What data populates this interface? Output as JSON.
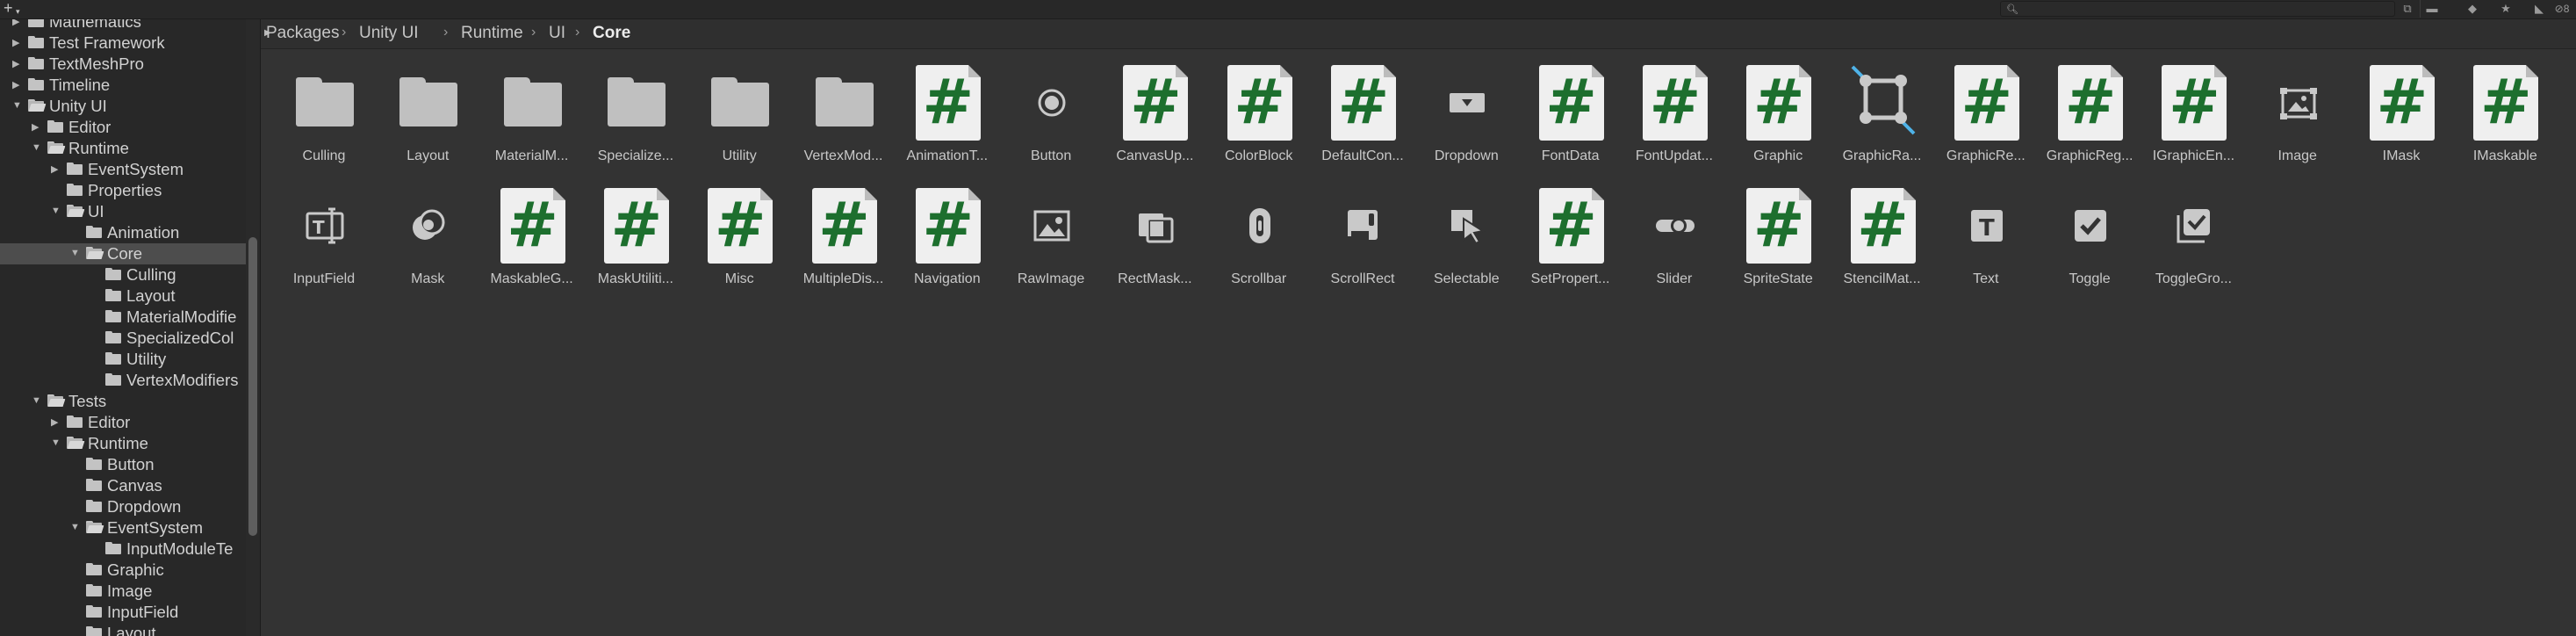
{
  "toolbar": {
    "add_icon": "plus-icon",
    "search_placeholder": "",
    "hidden_count": "8"
  },
  "tree": {
    "items": [
      {
        "label": "Mathematics",
        "depth": 1,
        "expanded": false,
        "has_children": true,
        "selected": false
      },
      {
        "label": "Test Framework",
        "depth": 1,
        "expanded": false,
        "has_children": true,
        "selected": false
      },
      {
        "label": "TextMeshPro",
        "depth": 1,
        "expanded": false,
        "has_children": true,
        "selected": false
      },
      {
        "label": "Timeline",
        "depth": 1,
        "expanded": false,
        "has_children": true,
        "selected": false
      },
      {
        "label": "Unity UI",
        "depth": 1,
        "expanded": true,
        "has_children": true,
        "selected": false
      },
      {
        "label": "Editor",
        "depth": 2,
        "expanded": false,
        "has_children": true,
        "selected": false
      },
      {
        "label": "Runtime",
        "depth": 2,
        "expanded": true,
        "has_children": true,
        "selected": false
      },
      {
        "label": "EventSystem",
        "depth": 3,
        "expanded": false,
        "has_children": true,
        "selected": false
      },
      {
        "label": "Properties",
        "depth": 3,
        "expanded": false,
        "has_children": false,
        "selected": false
      },
      {
        "label": "UI",
        "depth": 3,
        "expanded": true,
        "has_children": true,
        "selected": false
      },
      {
        "label": "Animation",
        "depth": 4,
        "expanded": false,
        "has_children": false,
        "selected": false
      },
      {
        "label": "Core",
        "depth": 4,
        "expanded": true,
        "has_children": true,
        "selected": true
      },
      {
        "label": "Culling",
        "depth": 5,
        "expanded": false,
        "has_children": false,
        "selected": false
      },
      {
        "label": "Layout",
        "depth": 5,
        "expanded": false,
        "has_children": false,
        "selected": false
      },
      {
        "label": "MaterialModifie",
        "depth": 5,
        "expanded": false,
        "has_children": false,
        "selected": false
      },
      {
        "label": "SpecializedCol",
        "depth": 5,
        "expanded": false,
        "has_children": false,
        "selected": false
      },
      {
        "label": "Utility",
        "depth": 5,
        "expanded": false,
        "has_children": false,
        "selected": false
      },
      {
        "label": "VertexModifiers",
        "depth": 5,
        "expanded": false,
        "has_children": false,
        "selected": false
      },
      {
        "label": "Tests",
        "depth": 2,
        "expanded": true,
        "has_children": true,
        "selected": false
      },
      {
        "label": "Editor",
        "depth": 3,
        "expanded": false,
        "has_children": true,
        "selected": false
      },
      {
        "label": "Runtime",
        "depth": 3,
        "expanded": true,
        "has_children": true,
        "selected": false
      },
      {
        "label": "Button",
        "depth": 4,
        "expanded": false,
        "has_children": false,
        "selected": false
      },
      {
        "label": "Canvas",
        "depth": 4,
        "expanded": false,
        "has_children": false,
        "selected": false
      },
      {
        "label": "Dropdown",
        "depth": 4,
        "expanded": false,
        "has_children": false,
        "selected": false
      },
      {
        "label": "EventSystem",
        "depth": 4,
        "expanded": true,
        "has_children": true,
        "selected": false
      },
      {
        "label": "InputModuleTe",
        "depth": 5,
        "expanded": false,
        "has_children": false,
        "selected": false
      },
      {
        "label": "Graphic",
        "depth": 4,
        "expanded": false,
        "has_children": false,
        "selected": false
      },
      {
        "label": "Image",
        "depth": 4,
        "expanded": false,
        "has_children": false,
        "selected": false
      },
      {
        "label": "InputField",
        "depth": 4,
        "expanded": false,
        "has_children": false,
        "selected": false
      },
      {
        "label": "Layout",
        "depth": 4,
        "expanded": false,
        "has_children": false,
        "selected": false
      }
    ]
  },
  "breadcrumb": [
    "Packages",
    "Unity UI",
    "Runtime",
    "UI",
    "Core"
  ],
  "assets": [
    {
      "name": "Culling",
      "kind": "folder",
      "icon": "folder-icon"
    },
    {
      "name": "Layout",
      "kind": "folder",
      "icon": "folder-icon"
    },
    {
      "name": "MaterialM...",
      "kind": "folder",
      "icon": "folder-icon"
    },
    {
      "name": "Specialize...",
      "kind": "folder",
      "icon": "folder-icon"
    },
    {
      "name": "Utility",
      "kind": "folder",
      "icon": "folder-icon"
    },
    {
      "name": "VertexMod...",
      "kind": "folder",
      "icon": "folder-icon"
    },
    {
      "name": "AnimationT...",
      "kind": "script",
      "icon": "csharp-script-icon"
    },
    {
      "name": "Button",
      "kind": "glyph",
      "icon": "button-icon"
    },
    {
      "name": "CanvasUp...",
      "kind": "script",
      "icon": "csharp-script-icon"
    },
    {
      "name": "ColorBlock",
      "kind": "script",
      "icon": "csharp-script-icon"
    },
    {
      "name": "DefaultCon...",
      "kind": "script",
      "icon": "csharp-script-icon"
    },
    {
      "name": "Dropdown",
      "kind": "glyph",
      "icon": "dropdown-icon"
    },
    {
      "name": "FontData",
      "kind": "script",
      "icon": "csharp-script-icon"
    },
    {
      "name": "FontUpdat...",
      "kind": "script",
      "icon": "csharp-script-icon"
    },
    {
      "name": "Graphic",
      "kind": "script",
      "icon": "csharp-script-icon"
    },
    {
      "name": "GraphicRa...",
      "kind": "glyph",
      "icon": "graphic-raycaster-icon"
    },
    {
      "name": "GraphicRe...",
      "kind": "script",
      "icon": "csharp-script-icon"
    },
    {
      "name": "GraphicReg...",
      "kind": "script",
      "icon": "csharp-script-icon"
    },
    {
      "name": "IGraphicEn...",
      "kind": "script",
      "icon": "csharp-script-icon"
    },
    {
      "name": "Image",
      "kind": "glyph",
      "icon": "image-icon"
    },
    {
      "name": "IMask",
      "kind": "script",
      "icon": "csharp-script-icon"
    },
    {
      "name": "IMaskable",
      "kind": "script",
      "icon": "csharp-script-icon"
    },
    {
      "name": "InputField",
      "kind": "glyph",
      "icon": "input-field-icon"
    },
    {
      "name": "Mask",
      "kind": "glyph",
      "icon": "mask-icon"
    },
    {
      "name": "MaskableG...",
      "kind": "script",
      "icon": "csharp-script-icon"
    },
    {
      "name": "MaskUtiliti...",
      "kind": "script",
      "icon": "csharp-script-icon"
    },
    {
      "name": "Misc",
      "kind": "script",
      "icon": "csharp-script-icon"
    },
    {
      "name": "MultipleDis...",
      "kind": "script",
      "icon": "csharp-script-icon"
    },
    {
      "name": "Navigation",
      "kind": "script",
      "icon": "csharp-script-icon"
    },
    {
      "name": "RawImage",
      "kind": "glyph",
      "icon": "raw-image-icon"
    },
    {
      "name": "RectMask...",
      "kind": "glyph",
      "icon": "rect-mask-icon"
    },
    {
      "name": "Scrollbar",
      "kind": "glyph",
      "icon": "scrollbar-icon"
    },
    {
      "name": "ScrollRect",
      "kind": "glyph",
      "icon": "scroll-rect-icon"
    },
    {
      "name": "Selectable",
      "kind": "glyph",
      "icon": "selectable-icon"
    },
    {
      "name": "SetPropert...",
      "kind": "script",
      "icon": "csharp-script-icon"
    },
    {
      "name": "Slider",
      "kind": "glyph",
      "icon": "slider-icon"
    },
    {
      "name": "SpriteState",
      "kind": "script",
      "icon": "csharp-script-icon"
    },
    {
      "name": "StencilMat...",
      "kind": "script",
      "icon": "csharp-script-icon"
    },
    {
      "name": "Text",
      "kind": "glyph",
      "icon": "text-icon"
    },
    {
      "name": "Toggle",
      "kind": "glyph",
      "icon": "toggle-icon"
    },
    {
      "name": "ToggleGro...",
      "kind": "glyph",
      "icon": "toggle-group-icon"
    }
  ],
  "colors": {
    "script_hash": "#1d6f2e",
    "selection": "#4d4d4d",
    "raycaster_accent": "#4fb3e8"
  }
}
